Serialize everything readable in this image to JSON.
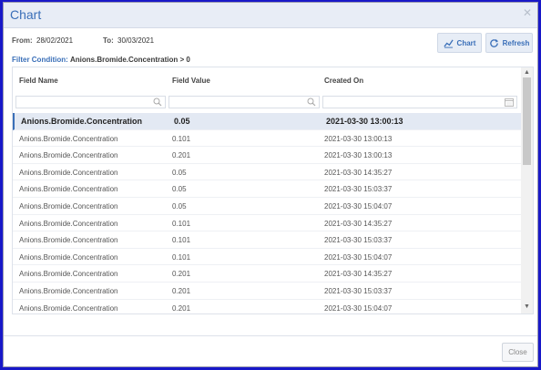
{
  "dialog": {
    "title": "Chart",
    "close_icon": "close-icon"
  },
  "filters": {
    "from_label": "From:",
    "from_value": "28/02/2021",
    "to_label": "To:",
    "to_value": "30/03/2021",
    "condition_label": "Filter Condition:",
    "condition_value": "Anions.Bromide.Concentration > 0"
  },
  "toolbar": {
    "chart_label": "Chart",
    "refresh_label": "Refresh"
  },
  "table": {
    "columns": [
      "Field Name",
      "Field Value",
      "Created On"
    ],
    "rows": [
      [
        "Anions.Bromide.Concentration",
        "0.05",
        "2021-03-30 13:00:13"
      ],
      [
        "Anions.Bromide.Concentration",
        "0.101",
        "2021-03-30 13:00:13"
      ],
      [
        "Anions.Bromide.Concentration",
        "0.201",
        "2021-03-30 13:00:13"
      ],
      [
        "Anions.Bromide.Concentration",
        "0.05",
        "2021-03-30 14:35:27"
      ],
      [
        "Anions.Bromide.Concentration",
        "0.05",
        "2021-03-30 15:03:37"
      ],
      [
        "Anions.Bromide.Concentration",
        "0.05",
        "2021-03-30 15:04:07"
      ],
      [
        "Anions.Bromide.Concentration",
        "0.101",
        "2021-03-30 14:35:27"
      ],
      [
        "Anions.Bromide.Concentration",
        "0.101",
        "2021-03-30 15:03:37"
      ],
      [
        "Anions.Bromide.Concentration",
        "0.101",
        "2021-03-30 15:04:07"
      ],
      [
        "Anions.Bromide.Concentration",
        "0.201",
        "2021-03-30 14:35:27"
      ],
      [
        "Anions.Bromide.Concentration",
        "0.201",
        "2021-03-30 15:03:37"
      ],
      [
        "Anions.Bromide.Concentration",
        "0.201",
        "2021-03-30 15:04:07"
      ]
    ]
  },
  "footer": {
    "close_label": "Close"
  },
  "colors": {
    "accent": "#3a6fb8",
    "window_border": "#1818c8"
  }
}
